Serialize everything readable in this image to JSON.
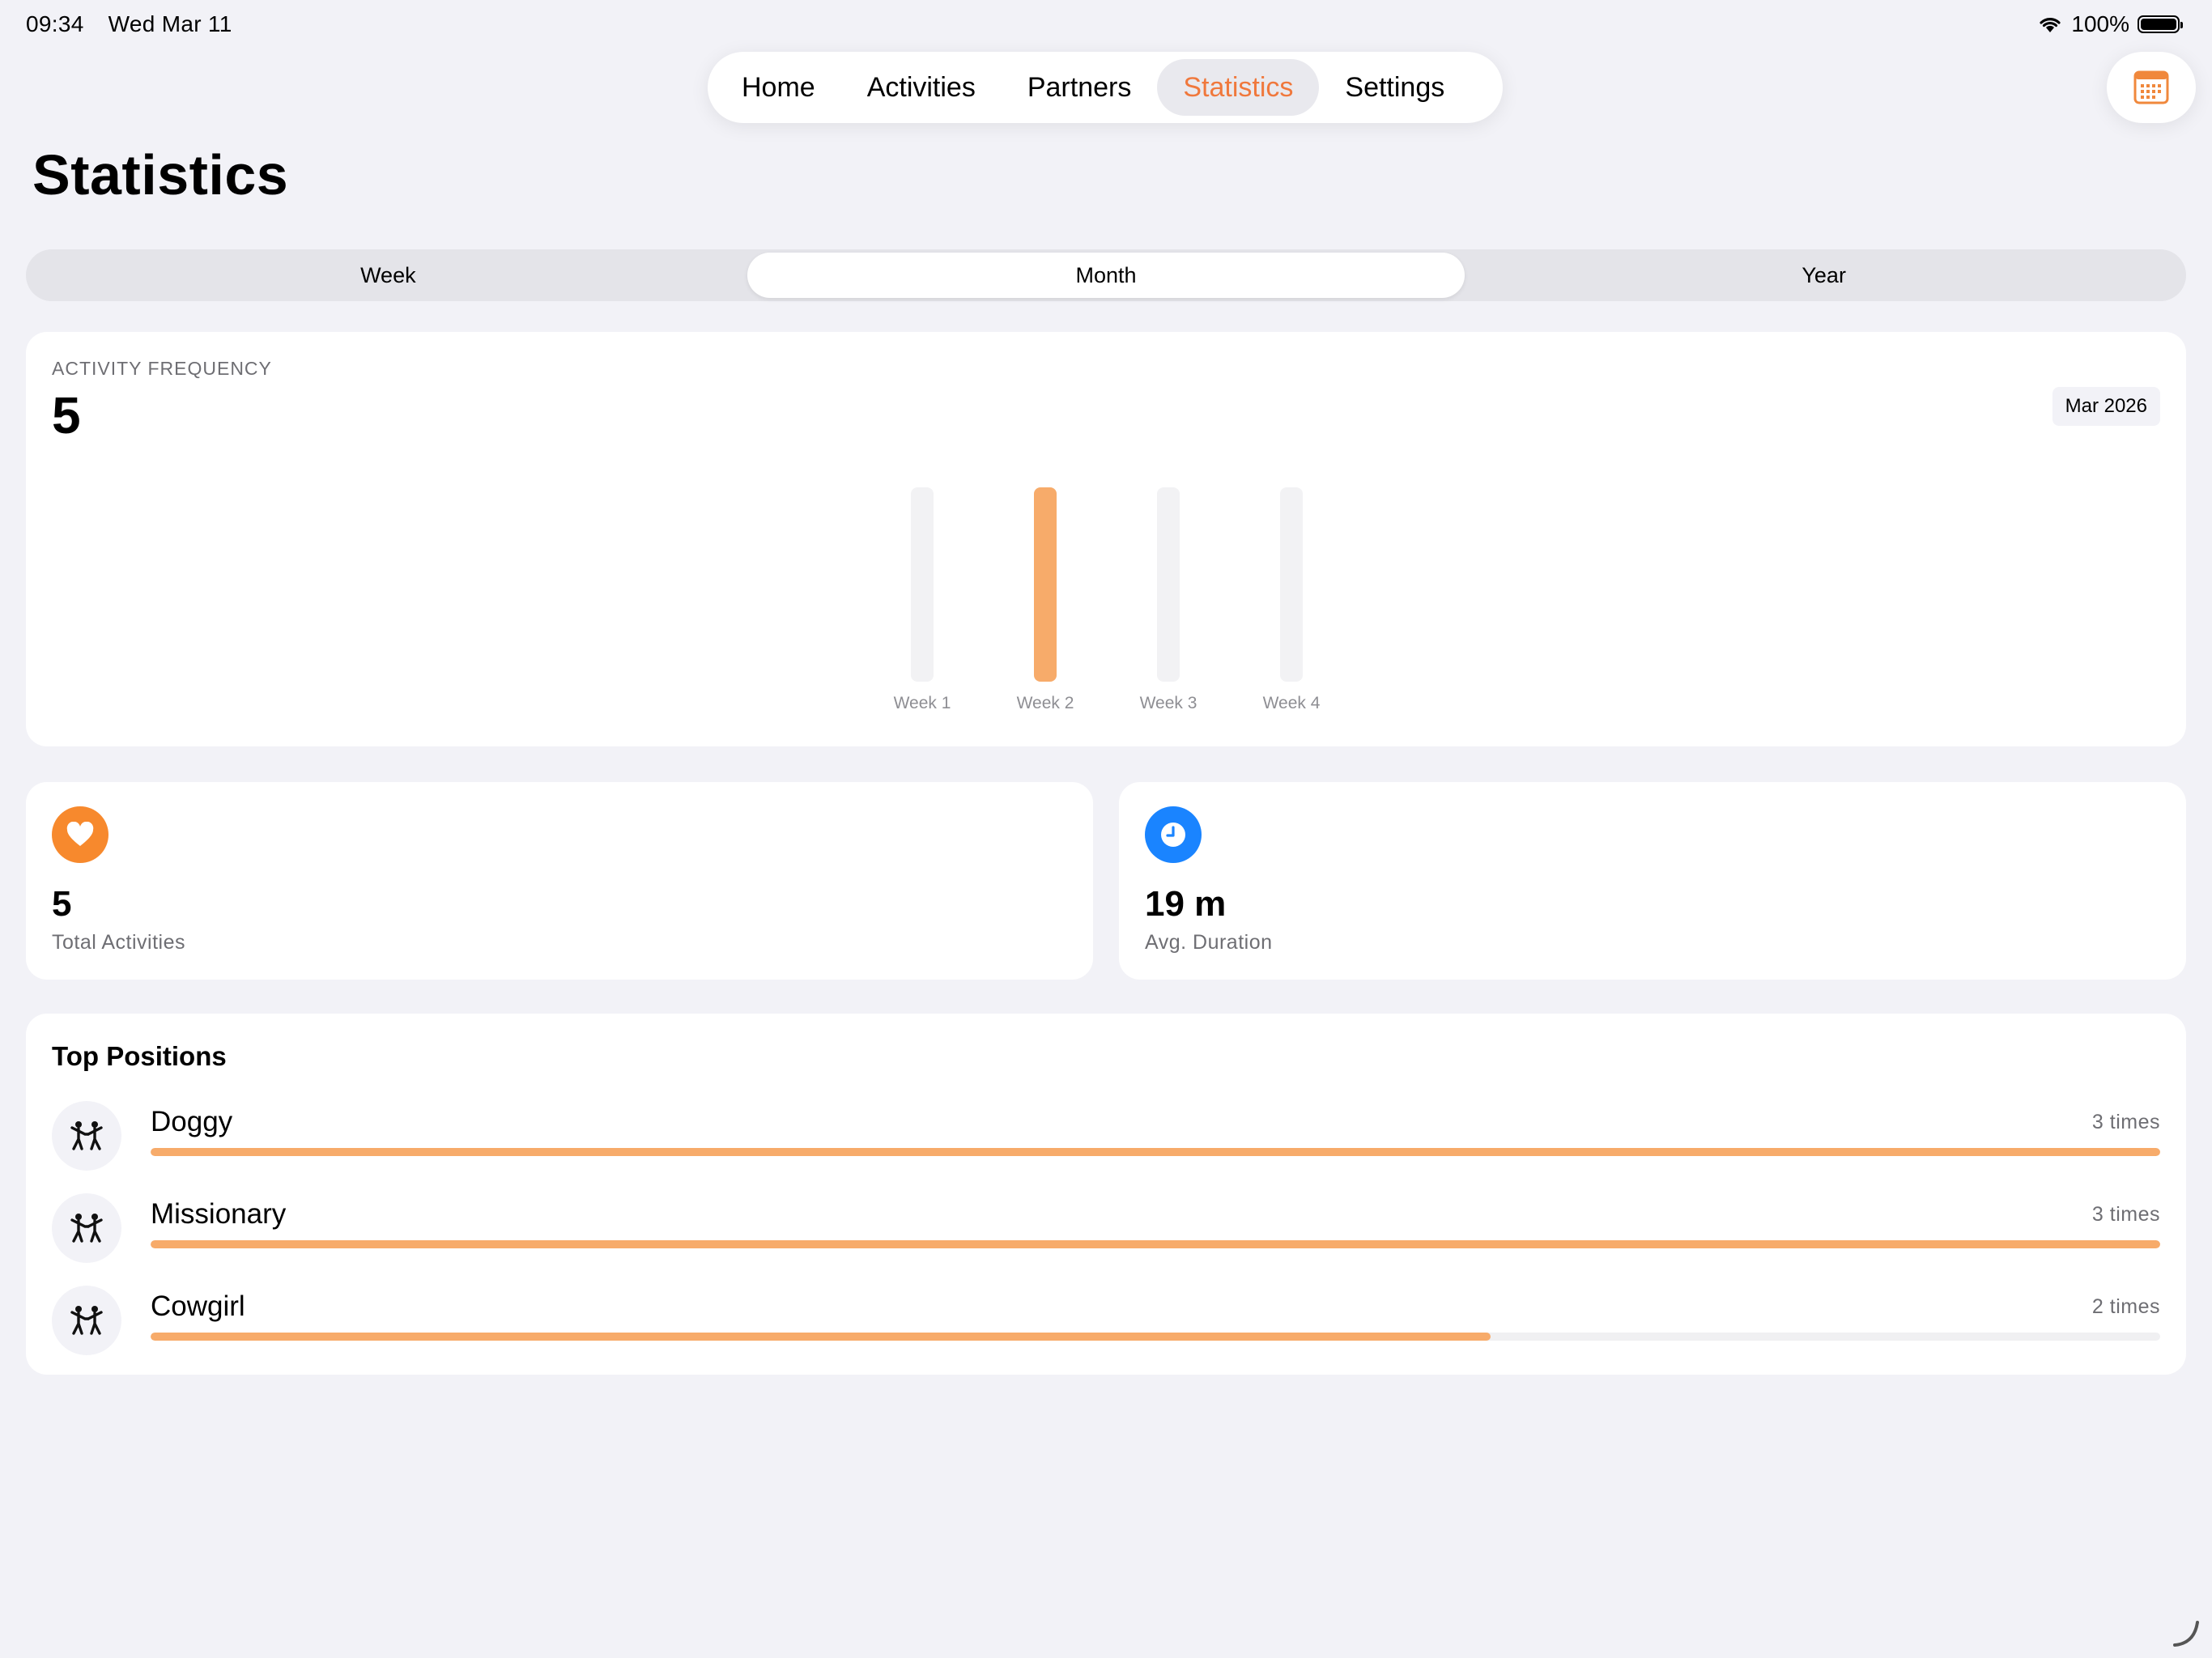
{
  "status_bar": {
    "time": "09:34",
    "date": "Wed Mar 11",
    "battery": "100%"
  },
  "nav": {
    "tabs": [
      {
        "label": "Home",
        "active": false
      },
      {
        "label": "Activities",
        "active": false
      },
      {
        "label": "Partners",
        "active": false
      },
      {
        "label": "Statistics",
        "active": true
      },
      {
        "label": "Settings",
        "active": false
      }
    ],
    "calendar_icon": "calendar-icon"
  },
  "page": {
    "title": "Statistics"
  },
  "period": {
    "options": [
      "Week",
      "Month",
      "Year"
    ],
    "selected": "Month"
  },
  "activity_frequency": {
    "label": "ACTIVITY FREQUENCY",
    "value": "5",
    "month": "Mar 2026"
  },
  "chart_data": {
    "type": "bar",
    "categories": [
      "Week 1",
      "Week 2",
      "Week 3",
      "Week 4"
    ],
    "values": [
      0,
      5,
      0,
      0
    ],
    "ylim": [
      0,
      5
    ],
    "highlight_color": "#f7ab6a",
    "track_color": "#f2f2f4"
  },
  "stats": {
    "total": {
      "icon": "heart-icon",
      "value": "5",
      "label": "Total Activities",
      "color": "#f7892d"
    },
    "duration": {
      "icon": "clock-icon",
      "value": "19 m",
      "label": "Avg. Duration",
      "color": "#1a84ff"
    }
  },
  "top_positions": {
    "title": "Top Positions",
    "items": [
      {
        "name": "Doggy",
        "count": "3 times",
        "fraction": 1.0
      },
      {
        "name": "Missionary",
        "count": "3 times",
        "fraction": 1.0
      },
      {
        "name": "Cowgirl",
        "count": "2 times",
        "fraction": 0.667
      }
    ]
  },
  "colors": {
    "accent": "#f0783c",
    "bar": "#f7ab6a",
    "background": "#f2f2f7"
  }
}
